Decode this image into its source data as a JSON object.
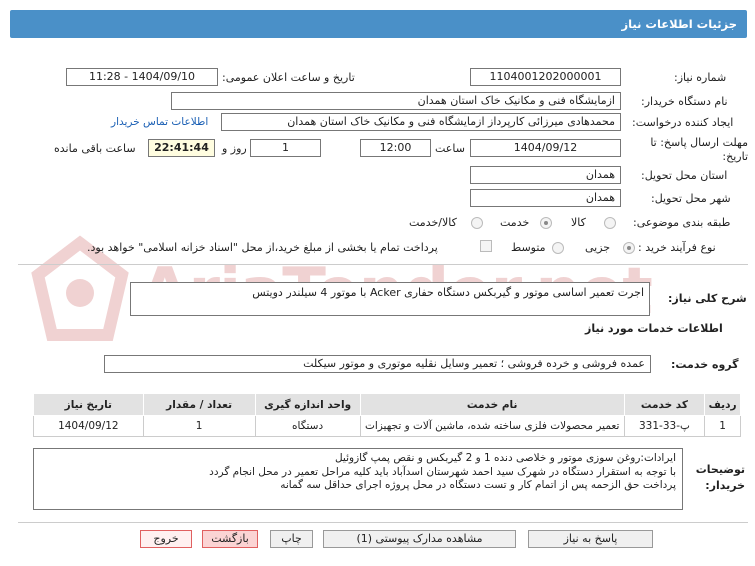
{
  "header": {
    "title": "جزئیات اطلاعات نیاز"
  },
  "colors": {
    "header_bg": "#4a90c8",
    "link": "#1a5fb4",
    "watermark": "#f0d2d2"
  },
  "watermark": {
    "text": "AriaTender.net"
  },
  "form": {
    "need_number": {
      "label": "شماره نیاز:",
      "value": "1104001202000001"
    },
    "announce_datetime": {
      "label": "تاریخ و ساعت اعلان عمومی:",
      "value": "1404/09/10 - 11:28"
    },
    "buyer_org": {
      "label": "نام دستگاه خریدار:",
      "value": "ازمایشگاه فنی و مکانیک خاک استان همدان"
    },
    "requester": {
      "label": "ایجاد کننده درخواست:",
      "value": "محمدهادی میرزائی کارپرداز ازمایشگاه فنی و مکانیک خاک استان همدان"
    },
    "contact_link": "اطلاعات تماس خریدار",
    "deadline": {
      "label": "مهلت ارسال پاسخ: تا تاریخ:",
      "date": "1404/09/12",
      "time_label": "ساعت",
      "time": "12:00",
      "day_count": "1",
      "day_label": "روز و",
      "remaining": "22:41:44",
      "remaining_label": "ساعت باقی مانده"
    },
    "delivery_province": {
      "label": "استان محل تحویل:",
      "value": "همدان"
    },
    "delivery_city": {
      "label": "شهر محل تحویل:",
      "value": "همدان"
    },
    "category": {
      "label": "طبقه بندی موضوعی:",
      "options": [
        "کالا",
        "خدمت",
        "کالا/خدمت"
      ],
      "selected": 1
    },
    "process_type": {
      "label": "نوع فرآیند خرید :",
      "options": [
        "جزیی",
        "متوسط"
      ],
      "selected": 0,
      "note": "پرداخت تمام یا بخشی از مبلغ خرید،از محل \"اسناد خزانه اسلامی\" خواهد بود."
    }
  },
  "description": {
    "label": "شرح کلی نیاز:",
    "value": "اجرت تعمیر اساسی موتور و گیربکس دستگاه حفاری Acker با موتور 4 سیلندر دویتس"
  },
  "services_section": {
    "title": "اطلاعات خدمات مورد نیاز",
    "group_label": "گروه خدمت:",
    "group_value": "عمده فروشی و خرده فروشی ؛ تعمیر وسایل نقلیه موتوری و موتور سیکلت"
  },
  "table": {
    "headers": [
      "ردیف",
      "کد خدمت",
      "نام خدمت",
      "واحد اندازه گیری",
      "تعداد / مقدار",
      "تاریخ نیاز"
    ],
    "rows": [
      [
        "1",
        "پ-33-331",
        "تعمیر محصولات فلزی ساخته شده، ماشین آلات و تجهیزات",
        "دستگاه",
        "1",
        "1404/09/12"
      ]
    ]
  },
  "buyer_notes": {
    "label": "توضیحات خریدار:",
    "lines": [
      "ایرادات:روغن سوزی موتور و خلاصی دنده 1 و 2 گیربکس و نقص پمپ گازوئیل",
      "با توجه به استقرار دستگاه در شهرک سید احمد شهرستان اسدآباد باید کلیه مراحل تعمیر در محل انجام گردد",
      "پرداخت حق الزحمه پس از اتمام کار و تست دستگاه در محل پروژه اجرای حداقل سه گمانه"
    ]
  },
  "buttons": {
    "reply": "پاسخ به نیاز",
    "attachments": "مشاهده مدارک پیوستی (1)",
    "print": "چاپ",
    "back": "بازگشت",
    "exit": "خروج"
  }
}
